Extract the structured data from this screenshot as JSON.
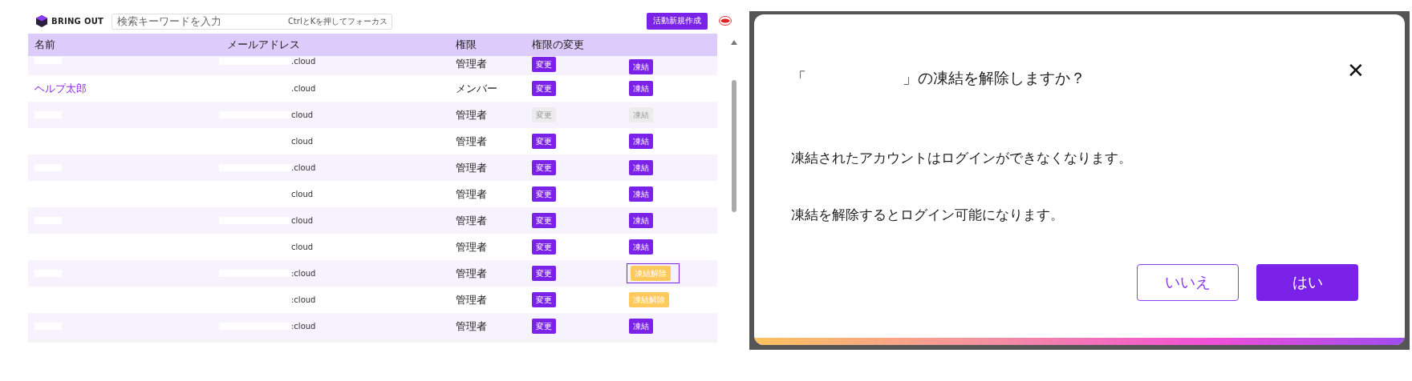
{
  "app": {
    "brand": "BRING OUT",
    "search": {
      "placeholder": "検索キーワードを入力",
      "hint": "CtrlとKを押してフォーカス"
    },
    "create_button": "活動新規作成"
  },
  "table": {
    "columns": [
      "名前",
      "メールアドレス",
      "権限",
      "権限の変更"
    ],
    "rows": [
      {
        "name": "",
        "redacted": true,
        "email": ".cloud",
        "role": "管理者",
        "change": "変更",
        "action": "凍結",
        "kind": "freeze",
        "disabled": false,
        "focused": false
      },
      {
        "name": "ヘルプ太郎",
        "email": ".cloud",
        "role": "メンバー",
        "change": "変更",
        "action": "凍結",
        "kind": "freeze",
        "disabled": false,
        "focused": false
      },
      {
        "name": "",
        "redacted": true,
        "email": "cloud",
        "role": "管理者",
        "change": "変更",
        "action": "凍結",
        "kind": "freeze",
        "disabled": true,
        "focused": false
      },
      {
        "name": "",
        "email": "cloud",
        "role": "管理者",
        "change": "変更",
        "action": "凍結",
        "kind": "freeze",
        "disabled": false,
        "focused": false
      },
      {
        "name": "",
        "redacted": true,
        "email": ".cloud",
        "role": "管理者",
        "change": "変更",
        "action": "凍結",
        "kind": "freeze",
        "disabled": false,
        "focused": false
      },
      {
        "name": "",
        "email": "cloud",
        "role": "管理者",
        "change": "変更",
        "action": "凍結",
        "kind": "freeze",
        "disabled": false,
        "focused": false
      },
      {
        "name": "",
        "redacted": true,
        "email": "cloud",
        "role": "管理者",
        "change": "変更",
        "action": "凍結",
        "kind": "freeze",
        "disabled": false,
        "focused": false
      },
      {
        "name": "",
        "email": "cloud",
        "role": "管理者",
        "change": "変更",
        "action": "凍結",
        "kind": "freeze",
        "disabled": false,
        "focused": false
      },
      {
        "name": "",
        "redacted": true,
        "email": ":cloud",
        "role": "管理者",
        "change": "変更",
        "action": "凍結解除",
        "kind": "unfreeze",
        "disabled": false,
        "focused": true
      },
      {
        "name": "",
        "email": ":cloud",
        "role": "管理者",
        "change": "変更",
        "action": "凍結解除",
        "kind": "unfreeze",
        "disabled": false,
        "focused": false
      },
      {
        "name": "",
        "redacted": true,
        "email": ":cloud",
        "role": "管理者",
        "change": "変更",
        "action": "凍結",
        "kind": "freeze",
        "disabled": false,
        "focused": false
      }
    ]
  },
  "dialog": {
    "title_open": "「",
    "title_rest": "」の凍結を解除しますか？",
    "close": "✕",
    "lines": [
      "凍結されたアカウントはログインができなくなります。",
      "凍結を解除するとログイン可能になります。"
    ],
    "buttons": [
      {
        "label": "いいえ",
        "kind": "secondary"
      },
      {
        "label": "はい",
        "kind": "primary"
      }
    ]
  }
}
